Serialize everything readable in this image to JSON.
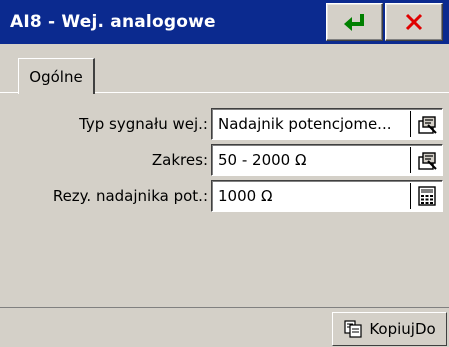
{
  "window": {
    "title": "AI8 - Wej. analogowe",
    "accent": "#0b2a8f",
    "ok_icon": "enter-arrow-icon",
    "close_icon": "close-x-icon"
  },
  "tabs": [
    {
      "label": "Ogólne",
      "active": true
    }
  ],
  "fields": [
    {
      "label": "Typ sygnału wej.:",
      "value": "Nadajnik potencjome...",
      "icon": "properties-icon"
    },
    {
      "label": "Zakres:",
      "value": "50 - 2000 Ω",
      "icon": "properties-icon"
    },
    {
      "label": "Rezy. nadajnika pot.:",
      "value": "1000 Ω",
      "icon": "keypad-icon"
    }
  ],
  "footer": {
    "copy_label": "KopiujDo",
    "copy_icon": "copy-icon"
  }
}
